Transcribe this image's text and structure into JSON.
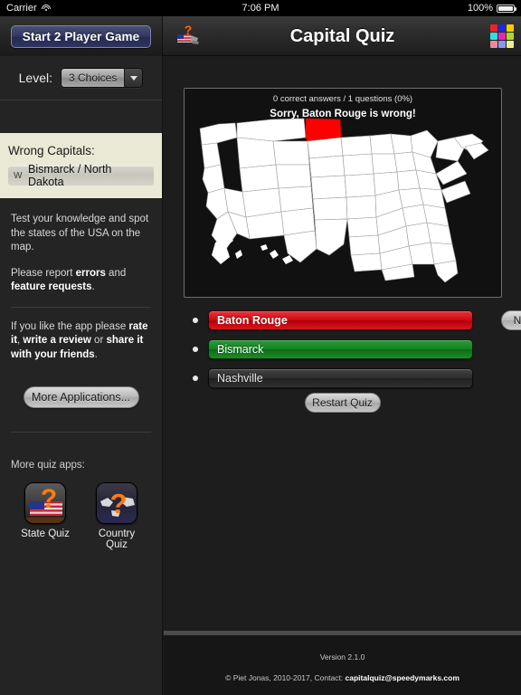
{
  "statusbar": {
    "carrier": "Carrier",
    "time": "7:06 PM",
    "battery": "100%",
    "wifi_icon": "wifi-icon",
    "battery_icon": "battery-icon"
  },
  "navbar": {
    "player_button": "Start 2 Player Game",
    "title": "Capital Quiz",
    "flag_icon": "usa-flag-question-icon",
    "grid_icon": "color-grid-icon",
    "grid_colors": [
      "#ee2222",
      "#1a29dd",
      "#ffcc00",
      "#33dddd",
      "#ee22bb",
      "#aadd22",
      "#ee8899",
      "#8899ee",
      "#eeee99"
    ]
  },
  "sidebar": {
    "level_label": "Level:",
    "level_value": "3 Choices",
    "level_options": [
      "3 Choices"
    ],
    "wrong_title": "Wrong Capitals:",
    "wrong_items": [
      {
        "letter": "W",
        "text": "Bismarck / North Dakota"
      }
    ],
    "info_1": "Test your knowledge and spot the states of the USA on the map.",
    "info_2_pre": "Please report ",
    "info_2_b1": "errors",
    "info_2_mid": " and ",
    "info_2_b2": "feature requests",
    "info_2_end": ".",
    "info_3_pre": "If you like the app please ",
    "info_3_b1": "rate it",
    "info_3_mid": ", ",
    "info_3_b2": "write a review",
    "info_3_mid2": " or ",
    "info_3_b3": "share it with your friends",
    "info_3_end": ".",
    "more_apps_button": "More Applications...",
    "more_quiz_label": "More quiz apps:",
    "apps": [
      {
        "name": "State Quiz",
        "icon": "state-quiz-app-icon"
      },
      {
        "name": "Country Quiz",
        "icon": "country-quiz-app-icon"
      }
    ]
  },
  "quiz": {
    "stats": "0 correct answers / 1 questions (0%)",
    "message": "Sorry, Baton Rouge is wrong!",
    "map_icon": "usa-map",
    "highlight_state": "North Dakota",
    "highlight_color": "#ff0000",
    "answers": [
      {
        "label": "Baton Rouge",
        "state": "wrong"
      },
      {
        "label": "Bismarck",
        "state": "correct"
      },
      {
        "label": "Nashville",
        "state": "neutral"
      }
    ],
    "next_button": "Next",
    "restart_button": "Restart Quiz"
  },
  "footer": {
    "version": "Version 2.1.0",
    "copyright_pre": "© Piet Jonas, 2010-2017, Contact: ",
    "contact_email": "capitalquiz@speedymarks.com"
  }
}
